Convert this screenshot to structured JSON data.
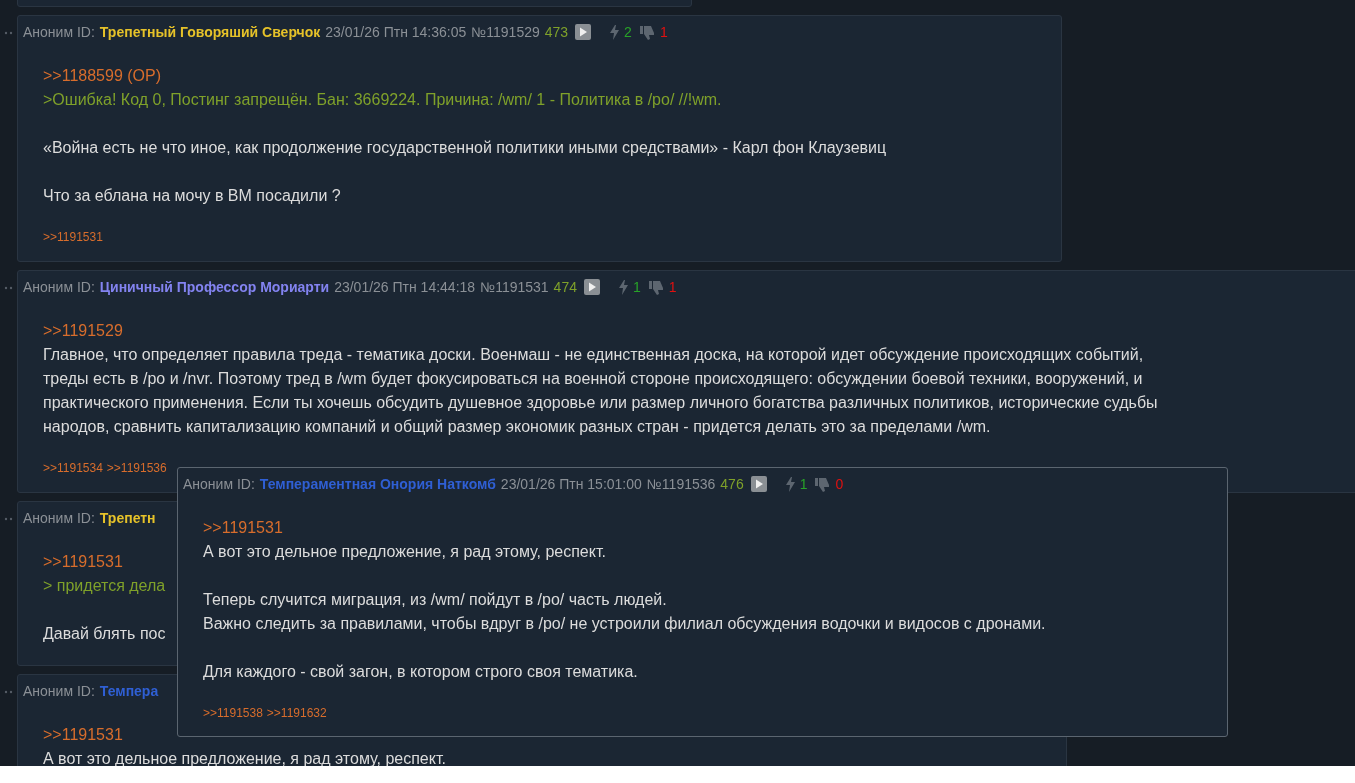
{
  "posts": [
    {
      "author": "Аноним ID:",
      "name": "Трепетный Говоряший Сверчок",
      "color": "#e6c229",
      "date": "23/01/26 Птн 14:36:05",
      "number": "№1191529",
      "count": "473",
      "likes": "2",
      "dislikes": "1",
      "paragraphs": [
        [
          {
            "kind": "link",
            "text": ">>1188599 (OP)"
          },
          {
            "kind": "quote",
            "text": ">Ошибка! Код 0, Постинг запрещён. Бан: 3669224. Причина: /wm/ 1 - Политика в /po/ //!wm."
          }
        ],
        [
          {
            "kind": "text",
            "text": "«Война есть не что иное, как продолжение государственной политики иными средствами» - Карл фон Клаузевиц"
          }
        ],
        [
          {
            "kind": "text",
            "text": "Что за еблана на мочу в ВМ посадили ?"
          }
        ]
      ],
      "replies": [
        ">>1191531"
      ]
    },
    {
      "author": "Аноним ID:",
      "name": "Циничный Профессор Мориарти",
      "color": "#8383f0",
      "date": "23/01/26 Птн 14:44:18",
      "number": "№1191531",
      "count": "474",
      "likes": "1",
      "dislikes": "1",
      "paragraphs": [
        [
          {
            "kind": "link",
            "text": ">>1191529"
          },
          {
            "kind": "text",
            "text": "Главное, что определяет правила треда - тематика доски. Военмаш - не единственная доска, на которой идет обсуждение происходящих событий,"
          },
          {
            "kind": "text",
            "text": "треды есть в /po и /nvr. Поэтому тред в /wm будет фокусироваться на военной стороне происходящего: обсуждении боевой техники, вооружений, и"
          },
          {
            "kind": "text",
            "text": "практического применения. Если ты хочешь обсудить душевное здоровье или размер личного богатства различных политиков, исторические судьбы"
          },
          {
            "kind": "text",
            "text": "народов, сравнить капитализацию компаний и общий размер экономик разных стран - придется делать это за пределами /wm."
          }
        ]
      ],
      "replies": [
        ">>1191534",
        ">>1191536"
      ]
    },
    {
      "author": "Аноним ID:",
      "name": "Трепетн",
      "color": "#e6c229",
      "paragraphs": [
        [
          {
            "kind": "link",
            "text": ">>1191531"
          },
          {
            "kind": "quote",
            "text": "> придется дела"
          }
        ],
        [
          {
            "kind": "text",
            "text": "Давай блять пос"
          }
        ]
      ]
    },
    {
      "author": "Аноним ID:",
      "name": "Темпера",
      "color": "#2f5fd4",
      "paragraphs": [
        [
          {
            "kind": "link",
            "text": ">>1191531"
          },
          {
            "kind": "text",
            "text": "А вот это дельное предложение, я рад этому, респект."
          }
        ]
      ]
    }
  ],
  "popup": {
    "author": "Аноним ID:",
    "name": "Темпераментная Онория Наткомб",
    "color": "#2f5fd4",
    "date": "23/01/26 Птн 15:01:00",
    "number": "№1191536",
    "count": "476",
    "likes": "1",
    "dislikes": "0",
    "paragraphs": [
      [
        {
          "kind": "link",
          "text": ">>1191531"
        },
        {
          "kind": "text",
          "text": "А вот это дельное предложение, я рад этому, респект."
        }
      ],
      [
        {
          "kind": "text",
          "text": "Теперь случится миграция, из /wm/ пойдут в /po/ часть людей."
        },
        {
          "kind": "text",
          "text": "Важно следить за правилами, чтобы вдруг в /po/ не устроили филиал обсуждения водочки и видосов с дронами."
        }
      ],
      [
        {
          "kind": "text",
          "text": "Для каждого - свой загон, в котором строго своя тематика."
        }
      ]
    ],
    "replies": [
      ">>1191538",
      ">>1191632"
    ]
  }
}
